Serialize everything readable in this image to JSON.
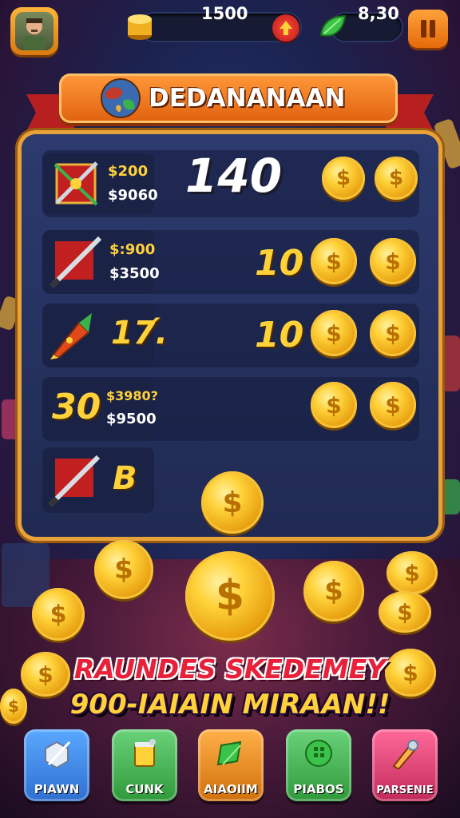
{
  "header": {
    "coins_value": "1500",
    "gems_value": "8,30"
  },
  "banner": {
    "title": "DEDANANAAN"
  },
  "shop": {
    "rows": [
      {
        "price_top": "$200",
        "price_bottom": "$9060",
        "amount": "140"
      },
      {
        "price_top": "$:900",
        "price_bottom": "$3500",
        "amount": "10"
      },
      {
        "icon_text": "17́.",
        "amount": "10"
      },
      {
        "icon_text": "30",
        "price_top": "$3980?",
        "price_bottom": "$9500"
      },
      {
        "icon_text": "B"
      }
    ]
  },
  "tagline": {
    "line1": "RAUNDES SKEDEMEY",
    "line2": "900-IAIAIN MIRAAN!!"
  },
  "bottom_nav": [
    {
      "label": "PIAWN",
      "color": "#2f7fe0"
    },
    {
      "label": "CUNK",
      "color": "#3aa24a"
    },
    {
      "label": "AIAOIIM",
      "color": "#e08a1a"
    },
    {
      "label": "PIABOS",
      "color": "#3aa24a"
    },
    {
      "label": "PARSENIE",
      "color": "#d63a6a"
    }
  ],
  "colors": {
    "accent_orange": "#e0600e",
    "gold": "#ffd23a",
    "panel_border": "#e8a23a"
  }
}
